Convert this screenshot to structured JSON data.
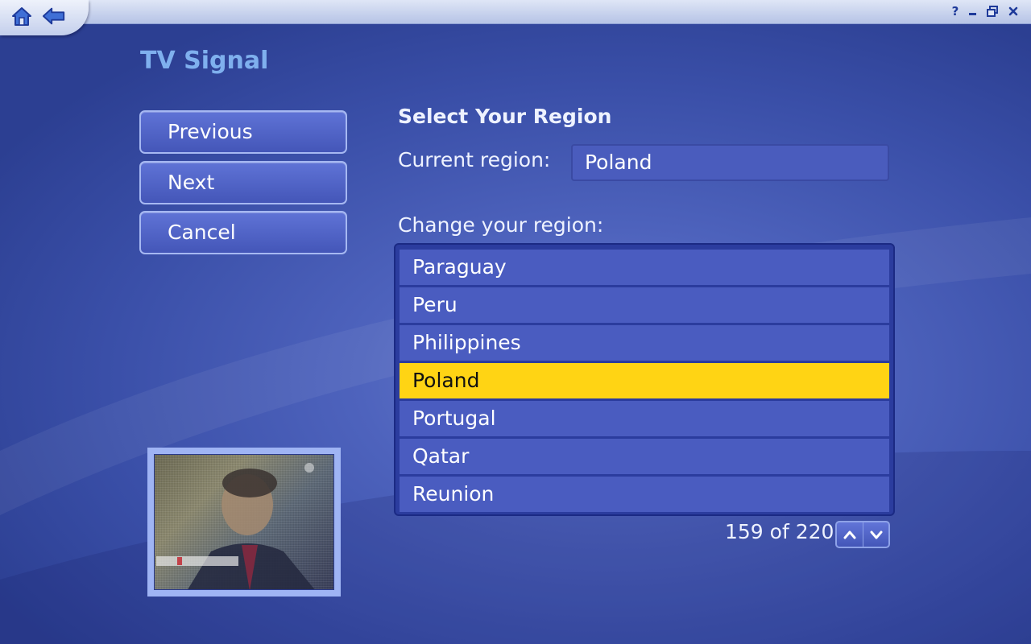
{
  "window": {
    "nav": {
      "home_icon": "home-icon",
      "back_icon": "back-arrow-icon"
    },
    "controls": {
      "help": "?",
      "minimize": "minimize-icon",
      "restore": "restore-icon",
      "close": "close-icon"
    }
  },
  "page": {
    "title": "TV Signal"
  },
  "buttons": {
    "previous": "Previous",
    "next": "Next",
    "cancel": "Cancel"
  },
  "region": {
    "heading": "Select Your Region",
    "current_label": "Current region:",
    "current_value": "Poland",
    "change_label": "Change your region:",
    "items": [
      "Paraguay",
      "Peru",
      "Philippines",
      "Poland",
      "Portugal",
      "Qatar",
      "Reunion"
    ],
    "selected": "Poland",
    "pager": "159 of 220"
  },
  "colors": {
    "accent": "#ffd414",
    "title": "#7fb0ee",
    "background": "#4e63bd"
  }
}
